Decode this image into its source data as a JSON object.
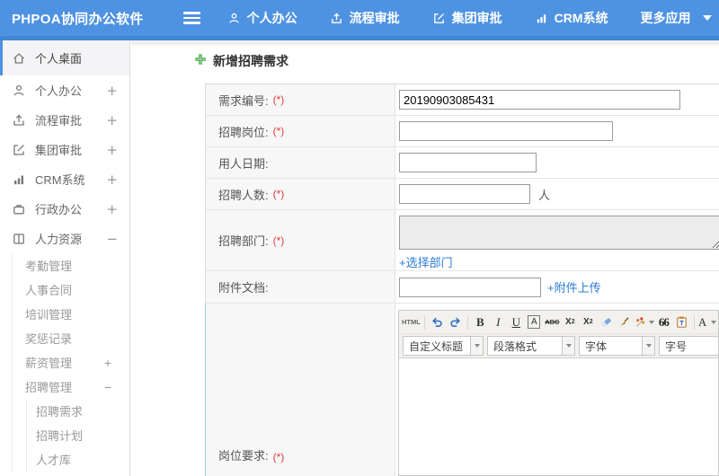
{
  "header": {
    "logo": "PHPOA协同办公软件",
    "nav": [
      {
        "label": "个人办公"
      },
      {
        "label": "流程审批"
      },
      {
        "label": "集团审批"
      },
      {
        "label": "CRM系统"
      },
      {
        "label": "更多应用"
      }
    ]
  },
  "sidebar": {
    "items": [
      {
        "label": "个人桌面"
      },
      {
        "label": "个人办公",
        "toggle": "+"
      },
      {
        "label": "流程审批",
        "toggle": "+"
      },
      {
        "label": "集团审批",
        "toggle": "+"
      },
      {
        "label": "CRM系统",
        "toggle": "+"
      },
      {
        "label": "行政办公",
        "toggle": "+"
      },
      {
        "label": "人力资源",
        "toggle": "−"
      }
    ],
    "hr_sub": [
      {
        "label": "考勤管理"
      },
      {
        "label": "人事合同"
      },
      {
        "label": "培训管理"
      },
      {
        "label": "奖惩记录"
      },
      {
        "label": "薪资管理",
        "toggle": "+"
      },
      {
        "label": "招聘管理",
        "toggle": "−"
      }
    ],
    "recruit_sub": [
      {
        "label": "招聘需求"
      },
      {
        "label": "招聘计划"
      },
      {
        "label": "人才库"
      }
    ]
  },
  "main": {
    "title": "新增招聘需求",
    "form": {
      "req_mark": "(*)",
      "rows": [
        {
          "label": "需求编号:",
          "value": "20190903085431"
        },
        {
          "label": "招聘岗位:"
        },
        {
          "label": "用人日期:"
        },
        {
          "label": "招聘人数:",
          "suffix": "人"
        },
        {
          "label": "招聘部门:",
          "link": "+选择部门"
        },
        {
          "label": "附件文档:",
          "link": "+附件上传"
        },
        {
          "label": "岗位要求:"
        }
      ]
    },
    "editor": {
      "html_btn": "HTML",
      "bold": "B",
      "italic": "I",
      "underline": "U",
      "font_box": "A",
      "strike": "ABC",
      "sup_base": "X",
      "sup_s": "2",
      "sub_base": "X",
      "sub_s": "2",
      "quote": "66",
      "font_color": "A",
      "dropdowns": [
        {
          "label": "自定义标题"
        },
        {
          "label": "段落格式"
        },
        {
          "label": "字体"
        },
        {
          "label": "字号"
        }
      ]
    }
  },
  "colors": {
    "header_blue": "#4E92E2",
    "link_blue": "#2B7BD3",
    "required_red": "#E0393B",
    "plus_green": "#57B257"
  }
}
